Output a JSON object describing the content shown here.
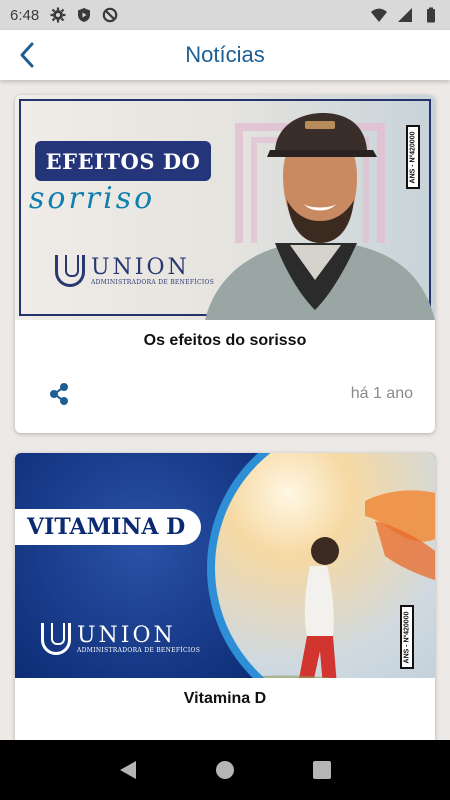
{
  "status_bar": {
    "time": "6:48",
    "left_icons": [
      "gear-icon",
      "shield-play-icon",
      "no-sync-icon"
    ],
    "right_icons": [
      "wifi-icon",
      "signal-icon",
      "battery-icon"
    ]
  },
  "header": {
    "title": "Notícias",
    "back_icon": "chevron-left-icon"
  },
  "colors": {
    "accent": "#1d5f95",
    "brand_navy": "#25357a",
    "status_bar_bg": "#d9d9d9",
    "page_bg": "#ece9e6"
  },
  "news": [
    {
      "banner": {
        "headline": "EFEITOS DO",
        "script": "sorriso",
        "logo_name": "UNION",
        "logo_sub": "ADMINISTRADORA DE BENEFÍCIOS",
        "ans": "ANS - Nº420000"
      },
      "title": "Os efeitos do sorisso",
      "time": "há 1 ano",
      "share_icon": "share-icon"
    },
    {
      "banner": {
        "headline": "VITAMINA D",
        "logo_name": "UNION",
        "logo_sub": "ADMINISTRADORA DE BENEFÍCIOS",
        "ans": "ANS - Nº420000"
      },
      "title": "Vitamina D"
    }
  ],
  "nav_bar": [
    "back-triangle-icon",
    "home-circle-icon",
    "recents-square-icon"
  ]
}
